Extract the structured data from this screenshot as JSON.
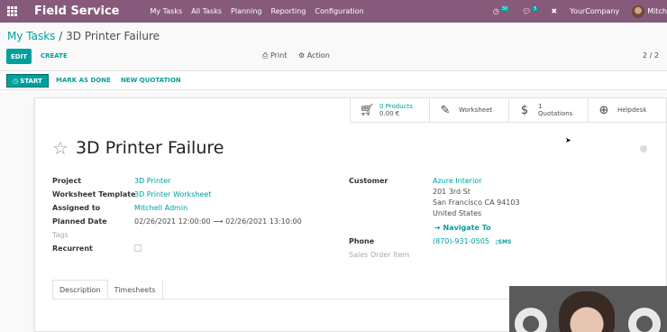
{
  "navbar": {
    "brand": "Field Service",
    "menu": [
      "My Tasks",
      "All Tasks",
      "Planning",
      "Reporting",
      "Configuration"
    ],
    "activity_count": "30",
    "messages_count": "5",
    "company": "YourCompany",
    "user": "Mitch"
  },
  "breadcrumb": {
    "parent": "My Tasks",
    "separator": "/",
    "current": "3D Printer Failure"
  },
  "control_panel": {
    "edit_label": "EDIT",
    "create_label": "CREATE",
    "print_label": "Print",
    "action_label": "Action",
    "pager": "2 / 2"
  },
  "statusbar": {
    "start_label": "START",
    "mark_done_label": "MARK AS DONE",
    "new_quotation_label": "NEW QUOTATION"
  },
  "smart_buttons": {
    "products_count": "0 Products",
    "products_amount": "0.00 €",
    "worksheet_label": "Worksheet",
    "quotations_count": "1",
    "quotations_label": "Quotations",
    "helpdesk_label": "Helpdesk"
  },
  "task": {
    "title": "3D Printer Failure",
    "fields": {
      "project_label": "Project",
      "project_value": "3D Printer",
      "worksheet_template_label": "Worksheet Template",
      "worksheet_template_value": "3D Printer Worksheet",
      "assigned_to_label": "Assigned to",
      "assigned_to_value": "Mitchell Admin",
      "planned_date_label": "Planned Date",
      "planned_start": "02/26/2021 12:00:00",
      "planned_end": "02/26/2021 13:10:00",
      "tags_label": "Tags",
      "recurrent_label": "Recurrent",
      "customer_label": "Customer",
      "customer_name": "Azure Interior",
      "customer_street": "201 3rd St",
      "customer_city": "San Francisco CA 94103",
      "customer_country": "United States",
      "navigate_label": "Navigate To",
      "phone_label": "Phone",
      "phone_value": "(870)-931-0505",
      "sms_label": "SMS",
      "sales_order_item_label": "Sales Order Item"
    }
  },
  "tabs": [
    "Description",
    "Timesheets"
  ]
}
